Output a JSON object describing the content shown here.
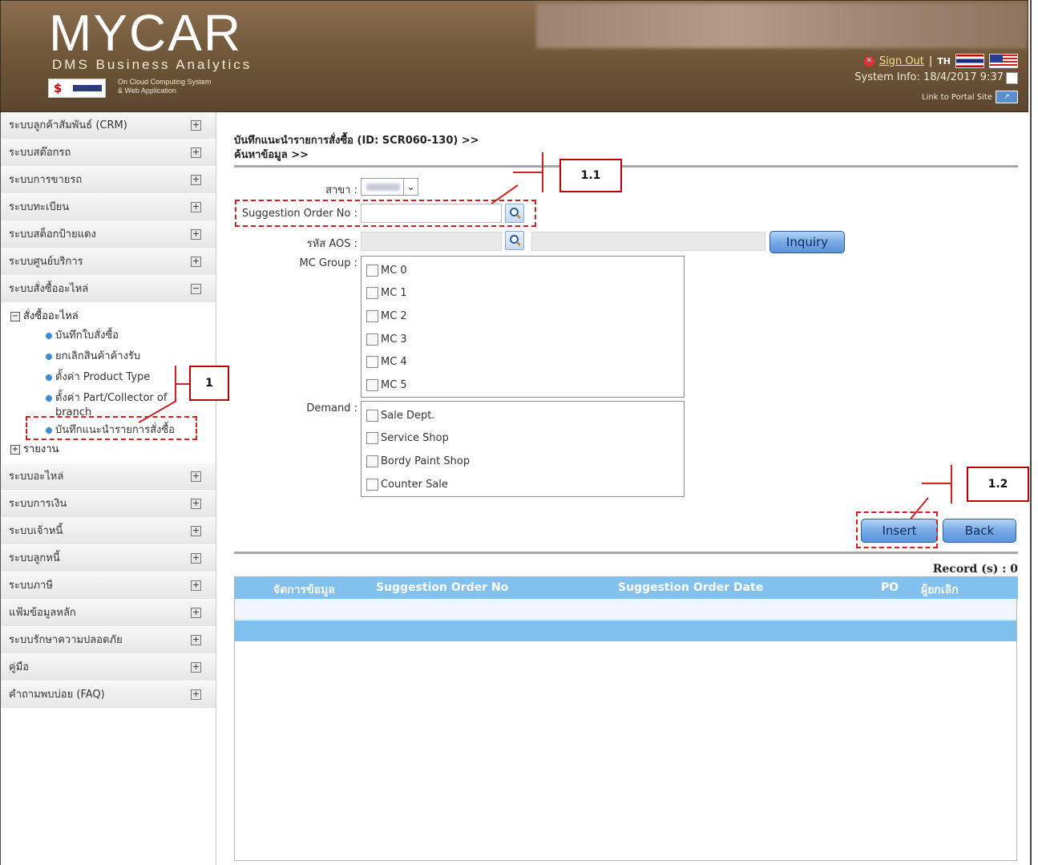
{
  "header": {
    "logo": "MYCAR",
    "logo_sub": "DMS Business Analytics",
    "cloud_line1": "On Cloud Computing System",
    "cloud_line2": "& Web Application",
    "sign_out": "Sign Out",
    "separator": "|",
    "lang": "TH",
    "system_info": "System Info: 18/4/2017 9:37",
    "portal_link": "Link to Portal Site"
  },
  "sidebar": {
    "items_top": [
      {
        "label": "ระบบลูกค้าสัมพันธ์ (CRM)",
        "toggle": "+"
      },
      {
        "label": "ระบบสต๊อกรถ",
        "toggle": "+"
      },
      {
        "label": "ระบบการขายรถ",
        "toggle": "+"
      },
      {
        "label": "ระบบทะเบียน",
        "toggle": "+"
      },
      {
        "label": "ระบบสต็อกป้ายแดง",
        "toggle": "+"
      },
      {
        "label": "ระบบศูนย์บริการ",
        "toggle": "+"
      },
      {
        "label": "ระบบสั่งซื้ออะไหล่",
        "toggle": "−"
      }
    ],
    "tree": {
      "group_label": "สั่งซื้ออะไหล่",
      "group_toggle": "−",
      "leaves": [
        "บันทึกใบสั่งซื้อ",
        "ยกเลิกสินค้าค้างรับ",
        "ตั้งค่า Product Type",
        "ตั้งค่า Part/Collector of branch",
        "บันทึกแนะนำรายการสั่งซื้อ"
      ],
      "report_label": "รายงาน",
      "report_toggle": "+"
    },
    "items_bottom": [
      {
        "label": "ระบบอะไหล่",
        "toggle": "+"
      },
      {
        "label": "ระบบการเงิน",
        "toggle": "+"
      },
      {
        "label": "ระบบเจ้าหนี้",
        "toggle": "+"
      },
      {
        "label": "ระบบลูกหนี้",
        "toggle": "+"
      },
      {
        "label": "ระบบภาษี",
        "toggle": "+"
      },
      {
        "label": "แฟ้มข้อมูลหลัก",
        "toggle": "+"
      },
      {
        "label": "ระบบรักษาความปลอดภัย",
        "toggle": "+"
      },
      {
        "label": "คู่มือ",
        "toggle": "+"
      },
      {
        "label": "คำถามพบบ่อย (FAQ)",
        "toggle": "+"
      }
    ]
  },
  "main": {
    "title_line1": "บันทึกแนะนำรายการสั่งซื้อ (ID: SCR060-130) >>",
    "title_line2": "ค้นหาข้อมูล >>",
    "form": {
      "branch_label": "สาขา :",
      "branch_prefix": ";",
      "suggestion_label": "Suggestion Order No :",
      "suggestion_value": "",
      "aos_label": "รหัส AOS :",
      "inquiry_button": "Inquiry",
      "mc_group_label": "MC Group :",
      "mc_options": [
        "MC 0",
        "MC 1",
        "MC 2",
        "MC 3",
        "MC 4",
        "MC 5"
      ],
      "demand_label": "Demand :",
      "demand_options": [
        "Sale Dept.",
        "Service Shop",
        "Bordy Paint Shop",
        "Counter Sale"
      ]
    },
    "insert_button": "Insert",
    "back_button": "Back",
    "record_label": "Record (s) : 0",
    "table_headers": [
      "จัดการข้อมูล",
      "Suggestion Order No",
      "Suggestion Order Date",
      "PO",
      "ผู้ยกเลิก"
    ]
  },
  "annotations": {
    "a1": "1",
    "a11": "1.1",
    "a12": "1.2"
  }
}
